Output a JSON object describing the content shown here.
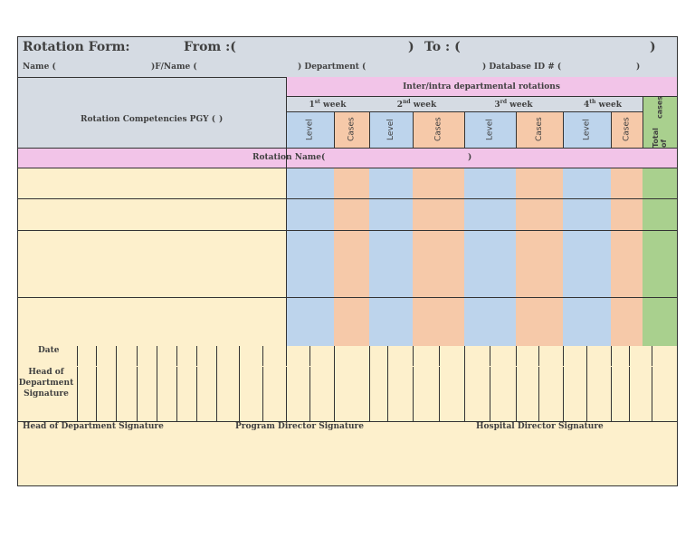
{
  "header": {
    "title": "Rotation Form:",
    "from_label": "From :(",
    "from_close": ")",
    "to_label": "To : (",
    "to_close": ")",
    "name_label": "Name (",
    "fname_label": ")F/Name (",
    "department_label": ")  Department (",
    "database_label": ") Database ID # (",
    "database_close": ")"
  },
  "competencies": {
    "label": "Rotation Competencies PGY (",
    "close": ")"
  },
  "rotations": {
    "banner": "Inter/intra departmental rotations",
    "weeks": [
      {
        "num": "1",
        "sup": "st",
        "word": " week"
      },
      {
        "num": "2",
        "sup": "nd",
        "word": " week"
      },
      {
        "num": "3",
        "sup": "rd",
        "word": " week"
      },
      {
        "num": "4",
        "sup": "th",
        "word": " week"
      }
    ],
    "level_label": "Level",
    "cases_label": "Cases",
    "total_label_1": "Total of",
    "total_label_2": "cases"
  },
  "rotation_name": {
    "label": "Rotation Name(",
    "close": ")"
  },
  "signoff": {
    "date_label": "Date",
    "hod_line1": "Head of",
    "hod_line2": "Department",
    "hod_line3": "Signature"
  },
  "footer": {
    "hod_sig": "Head of Department Signature",
    "pd_sig": "Program Director Signature",
    "hosp_sig": "Hospital Director Signature"
  },
  "colors": {
    "header_bg": "#d5dbe3",
    "pink": "#f2c4e8",
    "level_blue": "#bdd4ec",
    "cases_salmon": "#f6c9a9",
    "total_green": "#a9d08e",
    "body_cream": "#fdf0cc"
  }
}
